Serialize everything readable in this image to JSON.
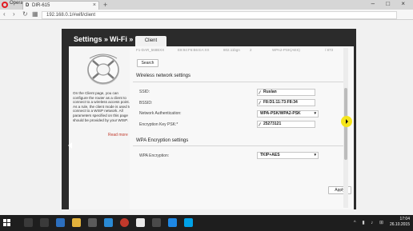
{
  "browser": {
    "app_label": "Opera",
    "tab_icon": "D",
    "tab_title": "DIR-615",
    "tab_close": "×",
    "new_tab": "+",
    "url": "192.168.0.1/#wifi/client",
    "window_controls": "– □ ×"
  },
  "router": {
    "breadcrumb": {
      "settings": "Settings »",
      "wifi": "Wi-Fi »"
    },
    "active_tab": "Client",
    "help": {
      "text": "On the Client page, you can configure the router as a client to connect to a wireless access point. As a rule, the client mode is used to connect to a WISP network. All parameters specified on this page should be provided by your WISP.",
      "read_more": "Read more"
    },
    "table_row": [
      "F1-DAR_568BXX",
      "E8:94:F6:B6:EA:XX",
      "802.11bgn",
      "2",
      "WPA2-PSK(AES)",
      "/ 873"
    ],
    "search_label": "Search",
    "wireless_section": {
      "title": "Wireless network settings",
      "ssid_label": "SSID:",
      "ssid_value": "Ruslan",
      "bssid_label": "BSSID:",
      "bssid_value": "F8:D1:11:73:F8:34",
      "auth_label": "Network Authentication:",
      "auth_value": "WPA-PSK/WPA2-PSK",
      "psk_label": "Encryption Key PSK:*",
      "psk_value": "25273121"
    },
    "wpa_section": {
      "title": "WPA Encryption settings",
      "enc_label": "WPA Encryption:",
      "enc_value": "TKIP+AES"
    },
    "apply_label": "Apply"
  },
  "taskbar": {
    "time": "17:04",
    "date": "26.10.2015"
  },
  "colors": {
    "router_frame": "#2b2b2b",
    "accent_red": "#c0392b",
    "cursor_highlight": "#f5e51b"
  }
}
